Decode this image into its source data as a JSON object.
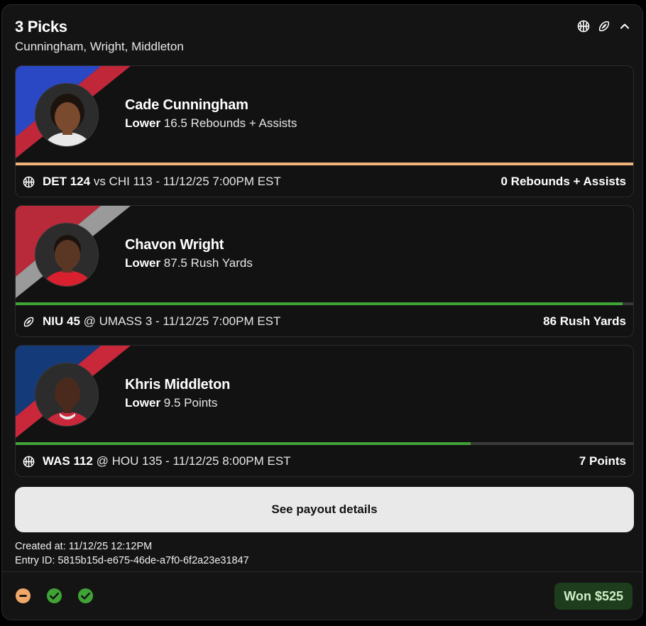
{
  "header": {
    "title": "3 Picks",
    "subtitle": "Cunningham, Wright, Middleton",
    "icons": [
      "basketball-icon",
      "football-icon",
      "chevron-up-icon"
    ]
  },
  "picks": [
    {
      "player": "Cade Cunningham",
      "direction": "Lower",
      "line": "16.5 Rebounds + Assists",
      "team_colors": [
        "#2a47c4",
        "#c0283a"
      ],
      "game_icon": "basketball-icon",
      "game_bold": "DET 124",
      "game_rest": "vs CHI 113 - 11/12/25 7:00PM EST",
      "result": "0 Rebounds + Assists",
      "progress_color": "#f2b27b",
      "progress_fraction": 1.0
    },
    {
      "player": "Chavon Wright",
      "direction": "Lower",
      "line": "87.5 Rush Yards",
      "team_colors": [
        "#b8293a",
        "#9a9a9a"
      ],
      "game_icon": "football-icon",
      "game_bold": "NIU 45",
      "game_rest": "@ UMASS 3 - 11/12/25 7:00PM EST",
      "result": "86 Rush Yards",
      "progress_color": "#3fa335",
      "progress_fraction": 0.983
    },
    {
      "player": "Khris Middleton",
      "direction": "Lower",
      "line": "9.5 Points",
      "team_colors": [
        "#143a7a",
        "#c8283a"
      ],
      "game_icon": "basketball-icon",
      "game_bold": "WAS 112",
      "game_rest": "@ HOU 135 - 11/12/25 8:00PM EST",
      "result": "7 Points",
      "progress_color": "#3fa335",
      "progress_fraction": 0.737
    }
  ],
  "payout_button": "See payout details",
  "created_at": "Created at: 11/12/25 12:12PM",
  "entry_id": "Entry ID: 5815b15d-e675-46de-a7f0-6f2a23e31847",
  "statuses": [
    "push-icon",
    "check-circle-icon",
    "check-circle-icon"
  ],
  "status_colors": {
    "push": "#f0a868",
    "win": "#3fa335"
  },
  "won_badge": "Won $525"
}
